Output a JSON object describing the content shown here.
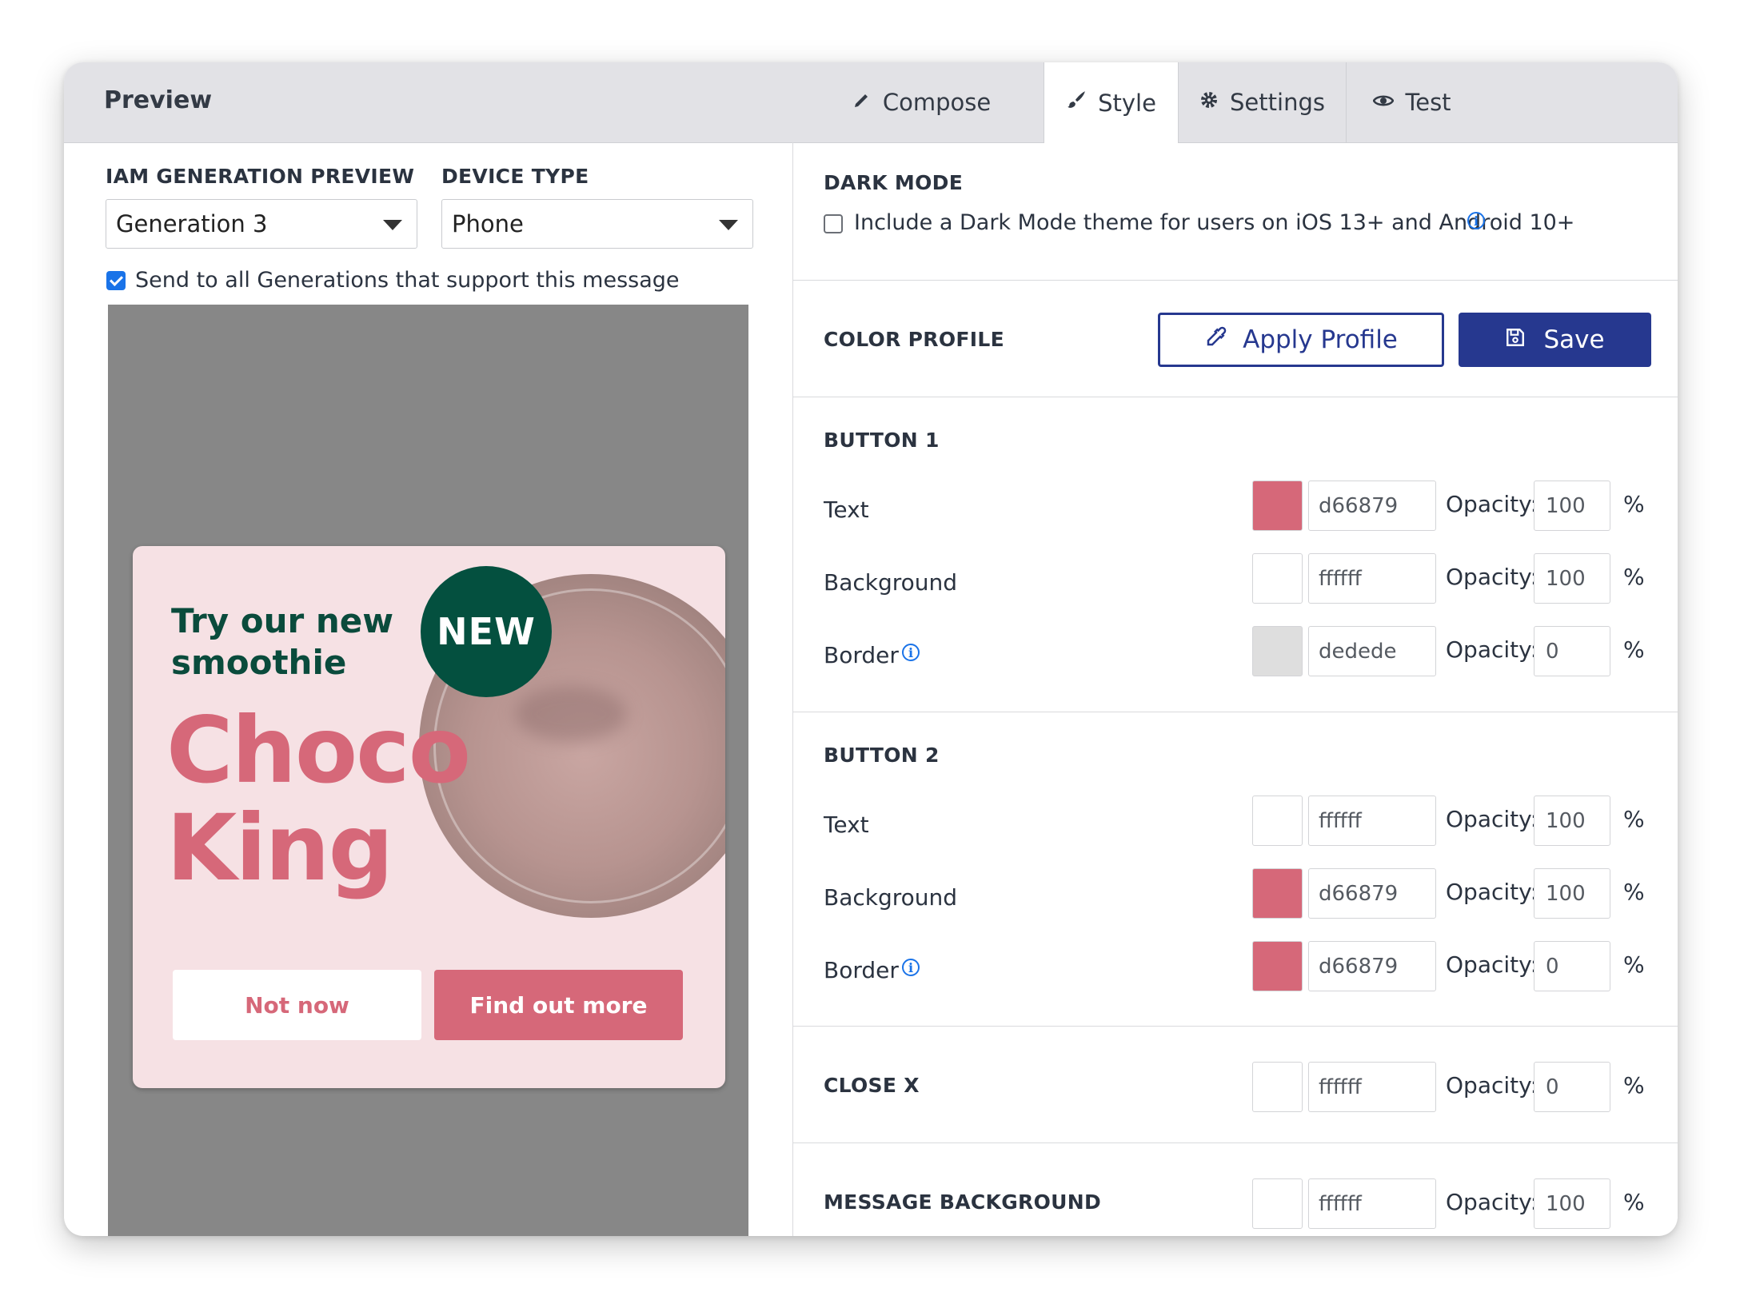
{
  "topbar": {
    "title": "Preview",
    "tabs": [
      {
        "label": "Compose",
        "icon": "pencil-icon"
      },
      {
        "label": "Style",
        "icon": "brush-icon"
      },
      {
        "label": "Settings",
        "icon": "gear-icon"
      },
      {
        "label": "Test",
        "icon": "eye-icon"
      }
    ],
    "active_tab": "Style"
  },
  "left": {
    "generation_label": "IAM GENERATION PREVIEW",
    "generation_value": "Generation 3",
    "device_label": "DEVICE TYPE",
    "device_value": "Phone",
    "send_all_label": "Send to all Generations that support this message",
    "send_all_checked": true
  },
  "message": {
    "badge": "NEW",
    "headline": "Try our new smoothie",
    "brand_line1": "Choco",
    "brand_line2": "King",
    "button1": "Not now",
    "button2": "Find out more"
  },
  "dark_mode": {
    "title": "DARK MODE",
    "checkbox_label": "Include a Dark Mode theme for users on iOS 13+ and Android 10+",
    "checked": false
  },
  "color_profile": {
    "title": "COLOR PROFILE",
    "apply_label": "Apply Profile",
    "save_label": "Save"
  },
  "labels": {
    "opacity": "Opacity:",
    "percent": "%"
  },
  "button1": {
    "title": "BUTTON 1",
    "rows": [
      {
        "label": "Text",
        "hex": "d66879",
        "color": "#d66879",
        "opacity": "100"
      },
      {
        "label": "Background",
        "hex": "ffffff",
        "color": "#ffffff",
        "opacity": "100"
      },
      {
        "label": "Border",
        "hex": "dedede",
        "color": "#dedede",
        "opacity": "0"
      }
    ]
  },
  "button2": {
    "title": "BUTTON 2",
    "rows": [
      {
        "label": "Text",
        "hex": "ffffff",
        "color": "#ffffff",
        "opacity": "100"
      },
      {
        "label": "Background",
        "hex": "d66879",
        "color": "#d66879",
        "opacity": "100"
      },
      {
        "label": "Border",
        "hex": "d66879",
        "color": "#d66879",
        "opacity": "0"
      }
    ]
  },
  "close_x": {
    "title": "CLOSE X",
    "hex": "ffffff",
    "color": "#ffffff",
    "opacity": "0"
  },
  "message_background": {
    "title": "MESSAGE BACKGROUND",
    "hex": "ffffff",
    "color": "#ffffff",
    "opacity": "100"
  },
  "colors": {
    "accent": "#26388f",
    "brand_pink": "#d66879",
    "brand_green": "#04503f",
    "checkbox_blue": "#1a73e8"
  }
}
